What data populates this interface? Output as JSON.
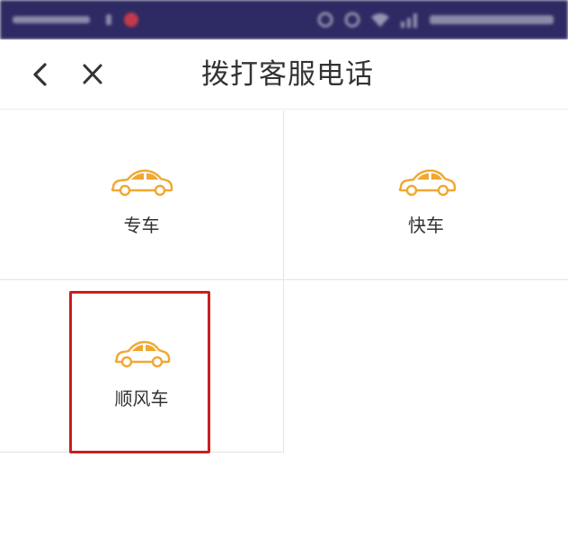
{
  "nav": {
    "title": "拨打客服电话"
  },
  "services": [
    {
      "label": "专车",
      "icon": "car-icon"
    },
    {
      "label": "快车",
      "icon": "car-icon"
    },
    {
      "label": "顺风车",
      "icon": "car-icon"
    }
  ],
  "colors": {
    "status_bar": "#2e2a63",
    "car_icon": "#f0a832",
    "highlight": "#c91f1f",
    "text": "#333333",
    "divider": "#e4e4e4"
  }
}
